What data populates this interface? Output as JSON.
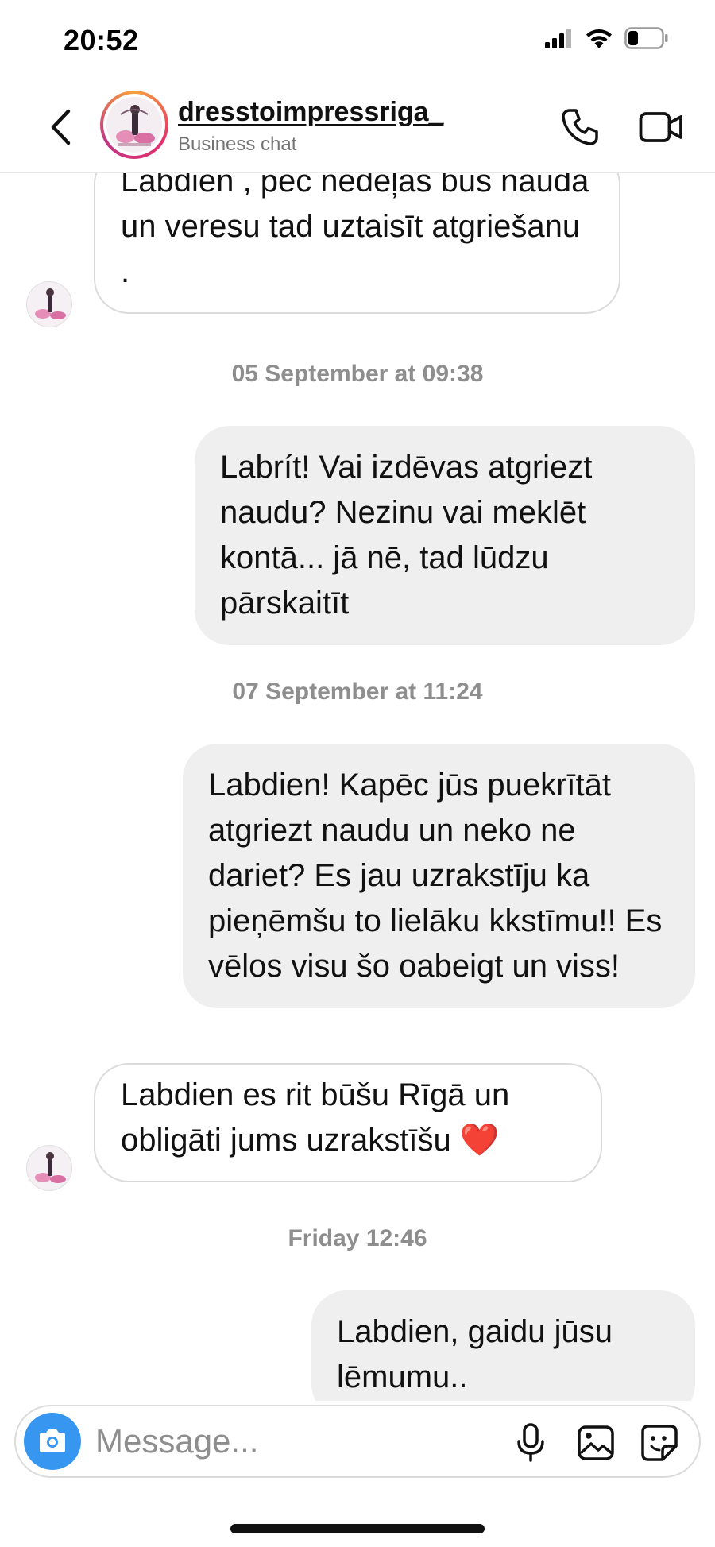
{
  "status_bar": {
    "time": "20:52"
  },
  "header": {
    "name": "dresstoimpressriga_",
    "subtitle": "Business chat"
  },
  "messages": [
    {
      "type": "incoming",
      "text": "Labdien , pēc nedēļas būs nauda un veresu tad uztaisīt atgriešanu ."
    },
    {
      "type": "timestamp",
      "text": "05 September at 09:38"
    },
    {
      "type": "outgoing",
      "text": "Labrít! Vai izdēvas atgriezt naudu? Nezinu vai meklēt kontā... jā nē, tad lūdzu pārskaitīt"
    },
    {
      "type": "timestamp",
      "text": "07 September at 11:24"
    },
    {
      "type": "outgoing",
      "text": "Labdien! Kapēc jūs puekrītāt atgriezt naudu un neko ne dariet? Es jau uzrakstīju ka pieņēmšu to lielāku kkstīmu!! Es vēlos visu šo oabeigt un viss!"
    },
    {
      "type": "incoming",
      "text": "Labdien es rit būšu Rīgā un obligāti jums uzrakstīšu ❤️"
    },
    {
      "type": "timestamp",
      "text": "Friday 12:46"
    },
    {
      "type": "outgoing",
      "text": "Labdien, gaidu jūsu lēmumu.."
    }
  ],
  "composer": {
    "placeholder": "Message..."
  },
  "colors": {
    "accent": "#3797f0",
    "outgoing_bubble": "#efefef",
    "incoming_border": "#dbdbdb",
    "timestamp": "#8e8e8e"
  }
}
